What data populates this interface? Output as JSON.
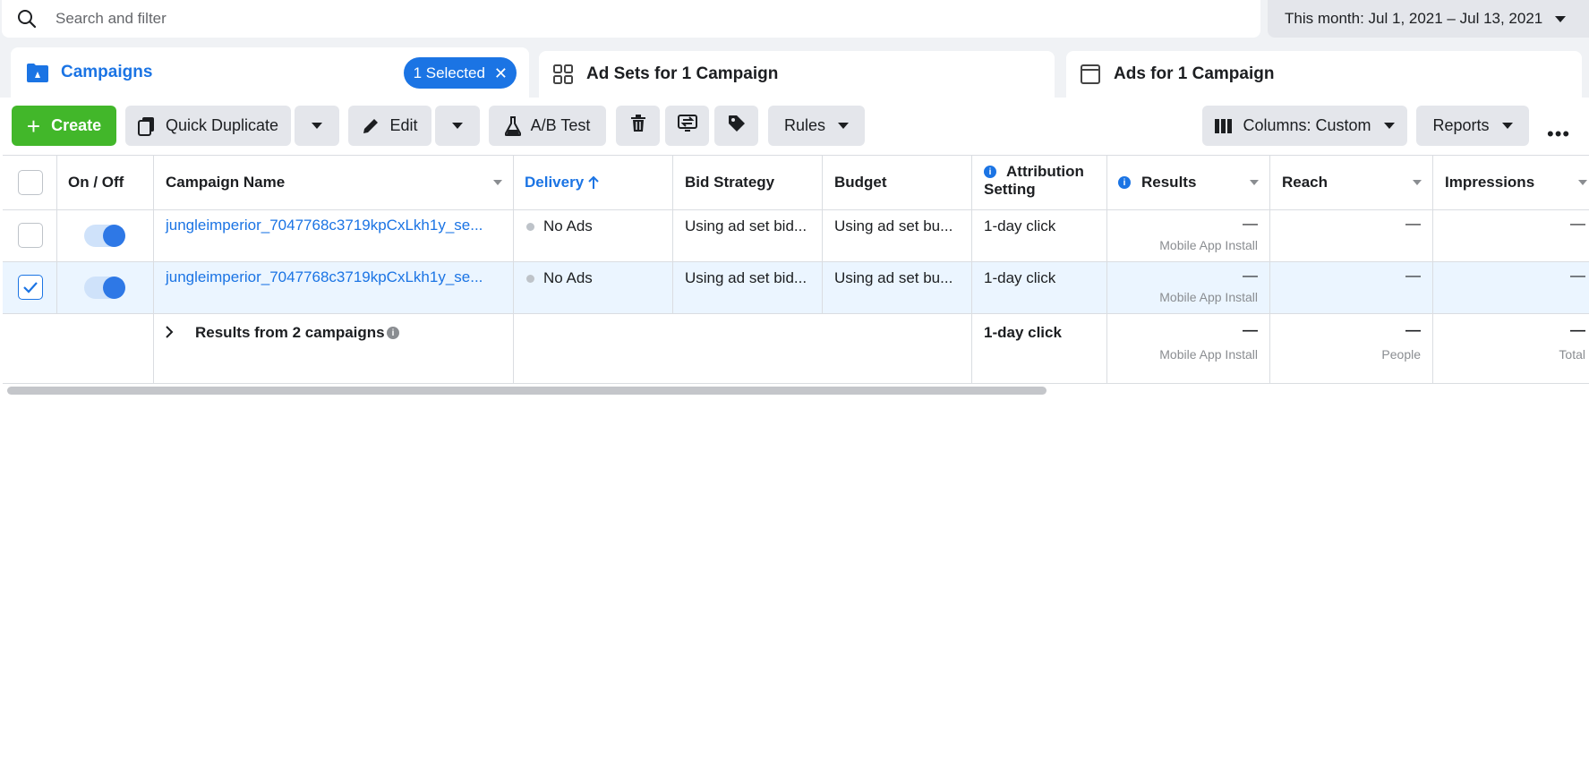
{
  "search": {
    "placeholder": "Search and filter"
  },
  "date_range": {
    "label": "This month: Jul 1, 2021 – Jul 13, 2021"
  },
  "tabs": [
    {
      "label": "Campaigns",
      "selected_pill": "1 Selected"
    },
    {
      "label": "Ad Sets for 1 Campaign"
    },
    {
      "label": "Ads for 1 Campaign"
    }
  ],
  "toolbar": {
    "create": "Create",
    "quick_duplicate": "Quick Duplicate",
    "edit": "Edit",
    "ab_test": "A/B Test",
    "rules": "Rules",
    "columns": "Columns: Custom",
    "reports": "Reports"
  },
  "table": {
    "headers": {
      "on_off": "On / Off",
      "campaign_name": "Campaign Name",
      "delivery": "Delivery",
      "bid_strategy": "Bid Strategy",
      "budget": "Budget",
      "attribution_line1": "Attribution",
      "attribution_line2": "Setting",
      "results": "Results",
      "reach": "Reach",
      "impressions": "Impressions"
    },
    "rows": [
      {
        "checked": false,
        "name": "jungleimperior_7047768c3719kpCxLkh1y_se...",
        "delivery": "No Ads",
        "bid_strategy": "Using ad set bid...",
        "budget": "Using ad set bu...",
        "attribution": "1-day click",
        "results": "—",
        "results_sub": "Mobile App Install",
        "reach": "—",
        "impressions": "—"
      },
      {
        "checked": true,
        "name": "jungleimperior_7047768c3719kpCxLkh1y_se...",
        "delivery": "No Ads",
        "bid_strategy": "Using ad set bid...",
        "budget": "Using ad set bu...",
        "attribution": "1-day click",
        "results": "—",
        "results_sub": "Mobile App Install",
        "reach": "—",
        "impressions": "—"
      }
    ],
    "summary": {
      "label": "Results from 2 campaigns",
      "attribution": "1-day click",
      "results": "—",
      "results_sub": "Mobile App Install",
      "reach": "—",
      "reach_sub": "People",
      "impressions": "—",
      "impressions_sub": "Total"
    }
  },
  "colors": {
    "accent": "#1b74e4",
    "create_green": "#42b72a",
    "selected_row": "#ebf5ff"
  }
}
